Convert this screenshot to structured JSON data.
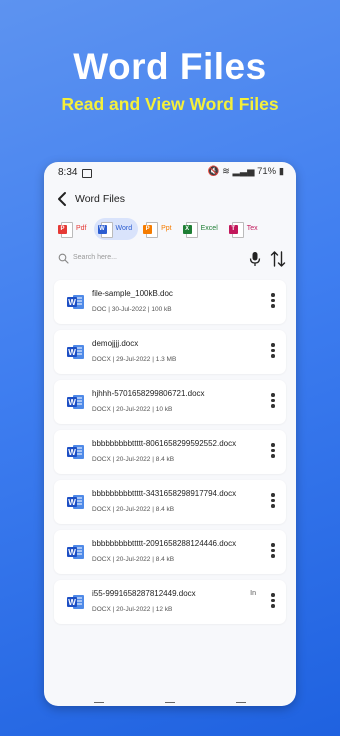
{
  "promo": {
    "title": "Word Files",
    "subtitle": "Read and View Word Files"
  },
  "status_bar": {
    "time": "8:34",
    "battery": "71%"
  },
  "header": {
    "title": "Word Files"
  },
  "tabs": [
    {
      "label": "Pdf",
      "icon": "pdf-icon",
      "color": "#e53935",
      "active": false
    },
    {
      "label": "Word",
      "icon": "word-icon",
      "color": "#2b5cd0",
      "active": true
    },
    {
      "label": "Ppt",
      "icon": "ppt-icon",
      "color": "#f57c00",
      "active": false
    },
    {
      "label": "Excel",
      "icon": "excel-icon",
      "color": "#1e7e34",
      "active": false
    },
    {
      "label": "Tex",
      "icon": "txt-icon",
      "color": "#c2185b",
      "active": false
    }
  ],
  "search": {
    "placeholder": "Search here..."
  },
  "files": [
    {
      "name": "file-sample_100kB.doc",
      "meta": "DOC | 30-Jul-2022 | 100 kB",
      "extra": ""
    },
    {
      "name": "demojjjj.docx",
      "meta": "DOCX | 29-Jul-2022 | 1.3 MB",
      "extra": ""
    },
    {
      "name": "hjhhh-5701658299806721.docx",
      "meta": "DOCX | 20-Jul-2022 | 10 kB",
      "extra": ""
    },
    {
      "name": "bbbbbbbbbttttt-8061658299592552.docx",
      "meta": "DOCX | 20-Jul-2022 | 8.4 kB",
      "extra": ""
    },
    {
      "name": "bbbbbbbbbttttt-3431658298917794.docx",
      "meta": "DOCX | 20-Jul-2022 | 8.4 kB",
      "extra": ""
    },
    {
      "name": "bbbbbbbbbttttt-2091658288124446.docx",
      "meta": "DOCX | 20-Jul-2022 | 8.4 kB",
      "extra": ""
    },
    {
      "name": "i55-9991658287812449.docx",
      "meta": "DOCX | 20-Jul-2022 | 12 kB",
      "extra": "In"
    }
  ],
  "colors": {
    "accent": "#2b5cd0",
    "promo_subtitle": "#f5f03a"
  }
}
